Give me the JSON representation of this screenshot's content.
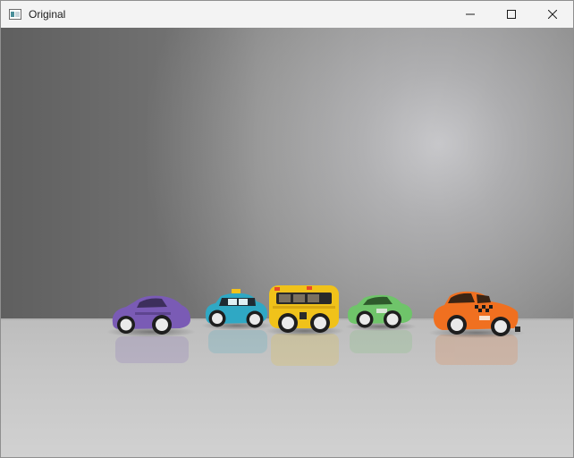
{
  "window": {
    "title": "Original",
    "app_icon": "window-app-icon",
    "buttons": {
      "minimize": "minimize-icon",
      "maximize": "maximize-icon",
      "close": "close-icon"
    }
  },
  "scene": {
    "description_icons": [
      "purple-car",
      "cyan-police-car",
      "yellow-bus",
      "green-car",
      "orange-taxi"
    ],
    "colors": {
      "purple_car": "#7a5bb5",
      "cyan_car": "#2fa8c4",
      "yellow_bus": "#f0c21a",
      "green_car": "#6fc46a",
      "orange_taxi": "#f07020"
    }
  }
}
